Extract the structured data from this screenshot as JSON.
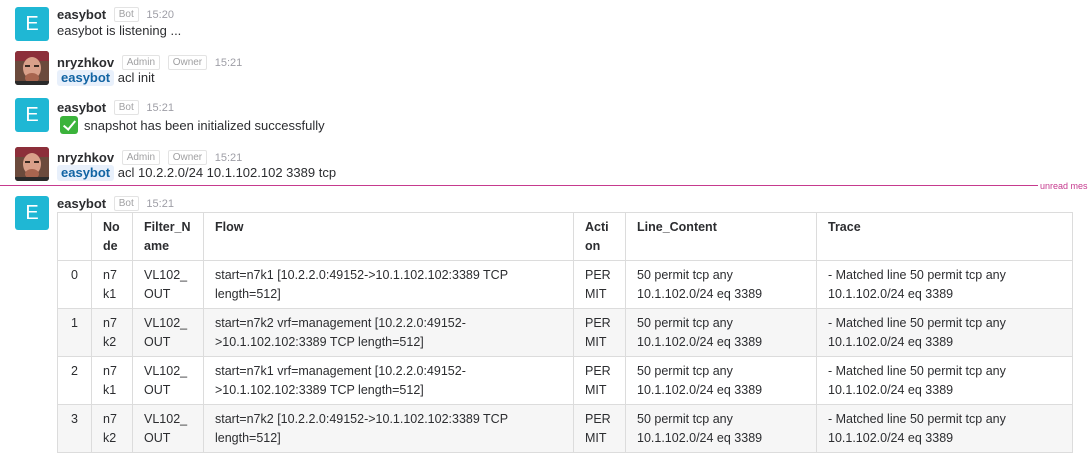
{
  "messages": [
    {
      "author": "easybot",
      "avatar_letter": "E",
      "badges": [
        "Bot"
      ],
      "time": "15:20",
      "text": "easybot is listening ..."
    },
    {
      "author": "nryzhkov",
      "badges": [
        "Admin",
        "Owner"
      ],
      "time": "15:21",
      "mention": "easybot",
      "text": "acl init"
    },
    {
      "author": "easybot",
      "avatar_letter": "E",
      "badges": [
        "Bot"
      ],
      "time": "15:21",
      "icon": "white-check-mark-icon",
      "text": "snapshot has been initialized successfully"
    },
    {
      "author": "nryzhkov",
      "badges": [
        "Admin",
        "Owner"
      ],
      "time": "15:21",
      "mention": "easybot",
      "text": "acl 10.2.2.0/24 10.1.102.102 3389 tcp"
    },
    {
      "author": "easybot",
      "avatar_letter": "E",
      "badges": [
        "Bot"
      ],
      "time": "15:21"
    }
  ],
  "unread_label": "unread mes",
  "table": {
    "headers": [
      "",
      "No\nde",
      "Filter_N\name",
      "Flow",
      "Acti\non",
      "Line_Content",
      "Trace"
    ],
    "rows": [
      [
        "0",
        "n7\nk1",
        "VL102_\nOUT",
        "start=n7k1 [10.2.2.0:49152->10.1.102.102:3389 TCP\nlength=512]",
        "PER\nMIT",
        "50 permit tcp any\n10.1.102.0/24 eq 3389",
        "- Matched line 50 permit tcp any\n10.1.102.0/24 eq 3389"
      ],
      [
        "1",
        "n7\nk2",
        "VL102_\nOUT",
        "start=n7k2 vrf=management [10.2.2.0:49152-\n>10.1.102.102:3389 TCP length=512]",
        "PER\nMIT",
        "50 permit tcp any\n10.1.102.0/24 eq 3389",
        "- Matched line 50 permit tcp any\n10.1.102.0/24 eq 3389"
      ],
      [
        "2",
        "n7\nk1",
        "VL102_\nOUT",
        "start=n7k1 vrf=management [10.2.2.0:49152-\n>10.1.102.102:3389 TCP length=512]",
        "PER\nMIT",
        "50 permit tcp any\n10.1.102.0/24 eq 3389",
        "- Matched line 50 permit tcp any\n10.1.102.0/24 eq 3389"
      ],
      [
        "3",
        "n7\nk2",
        "VL102_\nOUT",
        "start=n7k2 [10.2.2.0:49152->10.1.102.102:3389 TCP\nlength=512]",
        "PER\nMIT",
        "50 permit tcp any\n10.1.102.0/24 eq 3389",
        "- Matched line 50 permit tcp any\n10.1.102.0/24 eq 3389"
      ]
    ]
  },
  "colors": {
    "bot_avatar": "#1fb7d4",
    "mention_bg": "#e8f0fb",
    "mention_text": "#1264a3",
    "unread_line": "#c63a8e",
    "check_green": "#3bb33b"
  }
}
